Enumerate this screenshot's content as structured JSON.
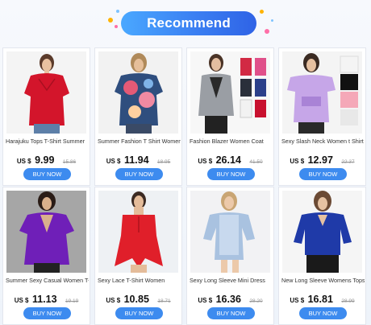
{
  "header": {
    "title": "Recommend",
    "accent_color": "#3b7ff2"
  },
  "products": [
    {
      "title": "Harajuku Tops T-Shirt Summer",
      "currency": "US $",
      "price": "9.99",
      "old_price": "15.86",
      "button": "BUY NOW"
    },
    {
      "title": "Summer Fashion T Shirt Women",
      "currency": "US $",
      "price": "11.94",
      "old_price": "18.95",
      "button": "BUY NOW"
    },
    {
      "title": "Fashion Blazer Women Coat",
      "currency": "US $",
      "price": "26.14",
      "old_price": "41.50",
      "button": "BUY NOW"
    },
    {
      "title": "Sexy Slash Neck Women t Shirt",
      "currency": "US $",
      "price": "12.97",
      "old_price": "22.37",
      "button": "BUY NOW"
    },
    {
      "title": "Summer Sexy Casual Women T-",
      "currency": "US $",
      "price": "11.13",
      "old_price": "19.19",
      "button": "BUY NOW"
    },
    {
      "title": "Sexy Lace T-Shirt Women",
      "currency": "US $",
      "price": "10.85",
      "old_price": "18.71",
      "button": "BUY NOW"
    },
    {
      "title": "Sexy Long Sleeve Mini Dress",
      "currency": "US $",
      "price": "16.36",
      "old_price": "28.20",
      "button": "BUY NOW"
    },
    {
      "title": "New Long Sleeve Womens Tops",
      "currency": "US $",
      "price": "16.81",
      "old_price": "28.99",
      "button": "BUY NOW"
    }
  ]
}
